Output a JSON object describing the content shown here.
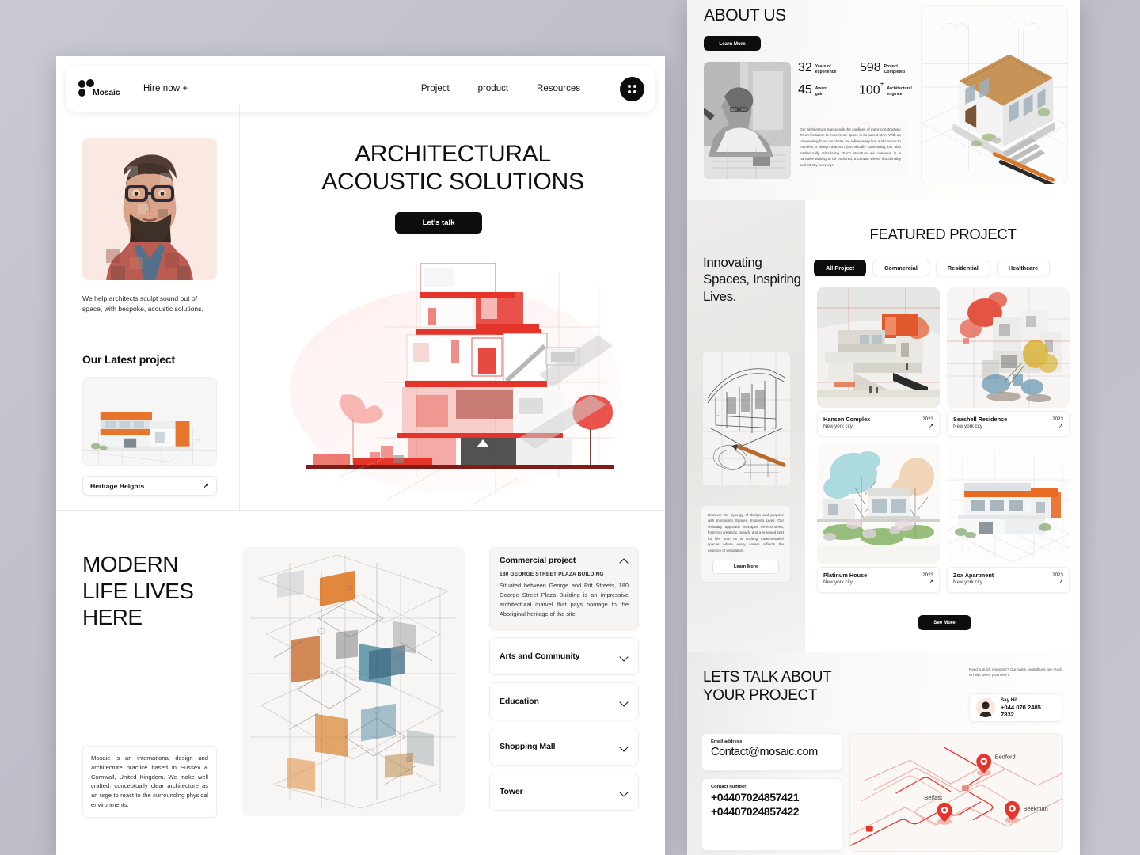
{
  "brand": {
    "name": "Mosaic",
    "logo_icon": "three-dots-logo"
  },
  "nav": {
    "hire": "Hire now +",
    "links": [
      "Project",
      "product",
      "Resources"
    ],
    "menu_icon": "grid-dots-menu-icon"
  },
  "hero": {
    "title_line1": "ARCHITECTURAL",
    "title_line2": "ACOUSTIC SOLUTIONS",
    "cta": "Let's talk",
    "portrait_alt": "bearded-architect-portrait",
    "lead": "We help architects sculpt sound out of space, with bespoke, acoustic solutions.",
    "latest_heading": "Our Latest project",
    "latest_project": "Heritage Heights",
    "latest_arrow_icon": "arrow-up-right-icon"
  },
  "modern": {
    "title_line1": "MODERN",
    "title_line2": "LIFE LIVES",
    "title_line3": "HERE",
    "note": "Mosaic is an international design and architecture practice based in Sussex & Cornwall, United Kingdom. We make well crafted, conceptually clear architecture as an urge to react to the surrounding physical environments."
  },
  "accordion": [
    {
      "label": "Commercial project",
      "open": true,
      "subtitle": "180 GEORGE STREET PLAZA BUILDING",
      "body": "Situated between George and Pitt Streets, 180 George Street Plaza Building is an impressive architectural marvel that pays homage to the Aboriginal heritage of the site."
    },
    {
      "label": "Arts and Community",
      "open": false
    },
    {
      "label": "Education",
      "open": false
    },
    {
      "label": "Shopping Mall",
      "open": false
    },
    {
      "label": "Tower",
      "open": false
    }
  ],
  "about": {
    "title": "ABOUT US",
    "learn_more": "Learn More",
    "photo_alt": "architect-at-drafting-desk",
    "render_alt": "modern-house-3d-render-with-pencils",
    "stats": [
      {
        "number": "32",
        "sup": "",
        "label_l1": "Years of",
        "label_l2": "experience"
      },
      {
        "number": "598",
        "sup": "",
        "label_l1": "Project",
        "label_l2": "Completed"
      },
      {
        "number": "45",
        "sup": "",
        "label_l1": "Award",
        "label_l2": "gain"
      },
      {
        "number": "100",
        "sup": "+",
        "label_l1": "Architectural",
        "label_l2": "engineer"
      }
    ],
    "paragraph": "Our architecture transcends the confines of mere construction; it's an invitation to experience space in its purest form. With an unwavering focus on clarity, we refine every line and contour to manifest a design that isn't just visually captivating, but also intellectually stimulating. Each structure we conceive is a narrative waiting to be explored, a canvas where functionality and artistry converge."
  },
  "featured": {
    "title": "FEATURED PROJECT",
    "heading": "Innovating Spaces, Inspiring Lives.",
    "sketch_alt": "architectural-sketch-with-pencil",
    "note": "Discover the synergy of design and purpose with Innovating Spaces, Inspiring Lives. Our visionary approach reshapes environments, fostering creativity, growth, and a renewed zest for life. Join us in crafting transformative spaces where every corner reflects the essence of inspiration.",
    "note_button": "Learn More",
    "filters": [
      {
        "label": "All Project",
        "active": true
      },
      {
        "label": "Commercial",
        "active": false
      },
      {
        "label": "Residential",
        "active": false
      },
      {
        "label": "Healthcare",
        "active": false
      }
    ],
    "projects": [
      {
        "name": "Hansen Complex",
        "city": "New york city",
        "year": "2023",
        "art": "orange-terraced-complex"
      },
      {
        "name": "Seashell Residence",
        "city": "New york city",
        "year": "2023",
        "art": "red-collage-building"
      },
      {
        "name": "Platinum House",
        "city": "New york city",
        "year": "2023",
        "art": "teal-garden-house"
      },
      {
        "name": "Zox Apartment",
        "city": "New york city",
        "year": "2023",
        "art": "orange-white-apartment"
      }
    ],
    "see_more": "See More",
    "card_arrow_icon": "arrow-up-right-icon"
  },
  "contact": {
    "title_line1": "LETS TALK ABOUT",
    "title_line2": "YOUR PROJECT",
    "note": "Need a quick response? Our sales consultants are ready to help, when you need it.",
    "say_hi_label": "Say Hi!",
    "say_hi_phone": "+044 070 2485 7832",
    "avatar_icon": "consultant-avatar",
    "email_caption": "Email address",
    "email_value": "Contact@mosaic.com",
    "phone_caption": "Contact number",
    "phone_1": "+04407024857421",
    "phone_2": "+04407024857422",
    "map": {
      "pins": [
        "Bedford",
        "Belfast",
        "Beekman"
      ],
      "accent_color": "#e5352b",
      "background": "#faf7f5"
    }
  },
  "theme": {
    "page_bg": "#c3c3cd",
    "panel_bg": "#ffffff",
    "ink": "#0f0f0f",
    "accent_dark": "#0d0d0d",
    "accent_red": "#e5352b",
    "accent_orange": "#e8662a"
  }
}
